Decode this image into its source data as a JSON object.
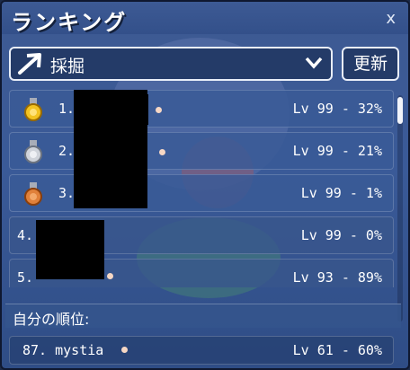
{
  "window": {
    "title": "ランキング",
    "close_label": "x"
  },
  "category": {
    "selected": "採掘",
    "icon": "pickaxe-arrow-icon"
  },
  "refresh_label": "更新",
  "rankings": [
    {
      "rank": "1.",
      "level": "Lv 99 - 32%",
      "medal": "gold"
    },
    {
      "rank": "2.",
      "level": "Lv 99 - 21%",
      "medal": "silver"
    },
    {
      "rank": "3.",
      "level": "Lv 99 - 1%",
      "medal": "bronze"
    },
    {
      "rank": "4.",
      "level": "Lv 99 - 0%",
      "medal": "none"
    },
    {
      "rank": "5.",
      "level": "Lv 93 - 89%",
      "medal": "none"
    }
  ],
  "my_rank": {
    "label": "自分の順位:",
    "rank": "87. mystia",
    "level": "Lv 61 - 60%"
  },
  "colors": {
    "gold": "#f3c321",
    "silver": "#cfd3da",
    "bronze": "#e0803a"
  }
}
